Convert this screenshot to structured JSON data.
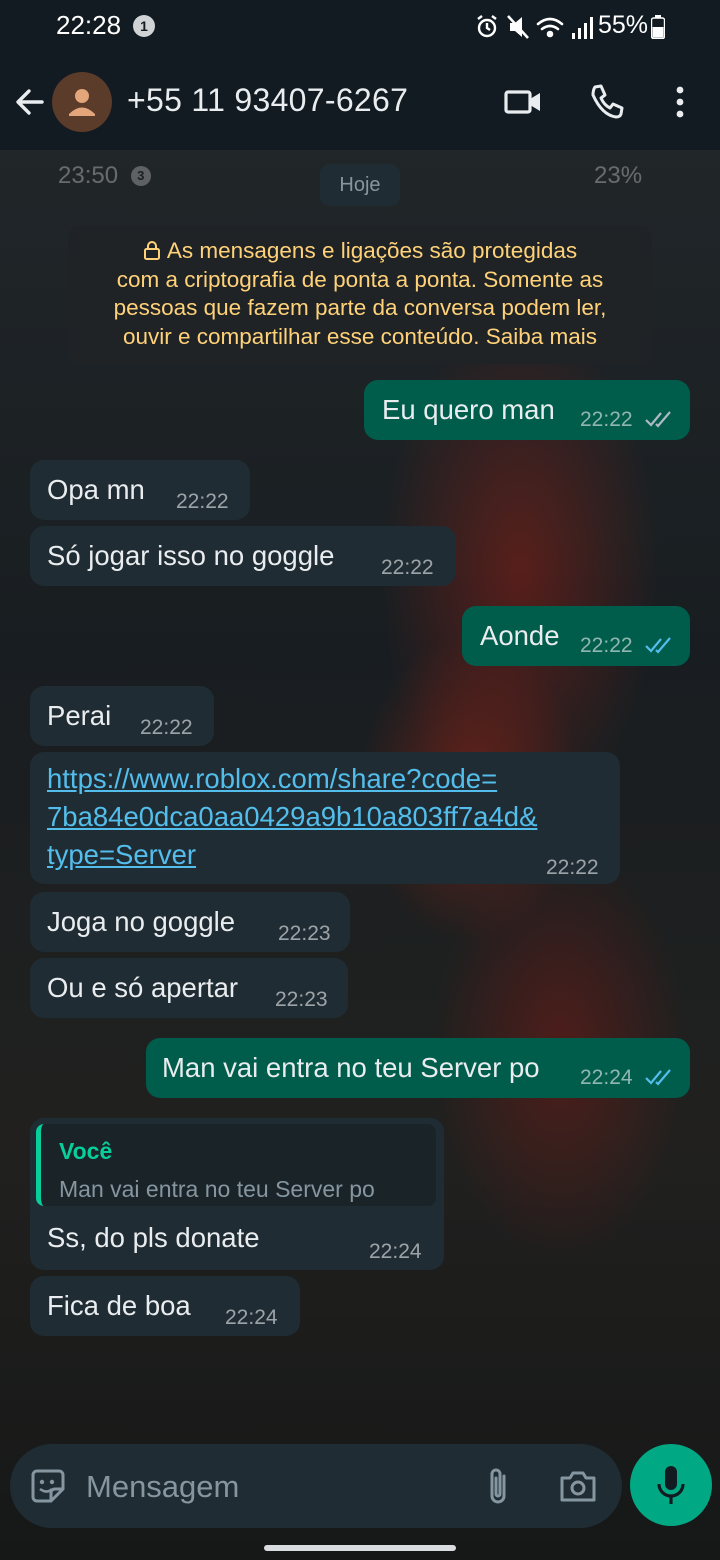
{
  "status_bar": {
    "time": "22:28",
    "notification_count": "1",
    "battery": "55%",
    "icons": [
      "alarm-icon",
      "mute-icon",
      "wifi-icon",
      "signal-icon",
      "battery-icon"
    ]
  },
  "header": {
    "contact": "+55 11 93407-6267",
    "icons": [
      "back-arrow-icon",
      "avatar-icon",
      "video-call-icon",
      "phone-icon",
      "more-vert-icon"
    ]
  },
  "wallpaper_ghost": {
    "time": "23:50",
    "badge": "3",
    "battery": "23%"
  },
  "chat": {
    "date_chip": "Hoje",
    "encryption_notice": [
      "As mensagens e ligações são protegidas",
      "com a criptografia de ponta a ponta. Somente as",
      "pessoas que fazem parte da conversa podem ler,",
      "ouvir e compartilhar esse conteúdo. Saiba mais"
    ],
    "messages": [
      {
        "dir": "out",
        "text": "Eu quero man",
        "time": "22:22",
        "status": "delivered"
      },
      {
        "dir": "in",
        "text": "Opa mn",
        "time": "22:22"
      },
      {
        "dir": "in",
        "text": "Só jogar isso no goggle",
        "time": "22:22"
      },
      {
        "dir": "out",
        "text": "Aonde",
        "time": "22:22",
        "status": "read"
      },
      {
        "dir": "in",
        "text": "Perai",
        "time": "22:22"
      },
      {
        "dir": "in",
        "link_lines": [
          "https://www.roblox.com/share?code=",
          "7ba84e0dca0aa0429a9b10a803ff7a4d&",
          "type=Server"
        ],
        "time": "22:22"
      },
      {
        "dir": "in",
        "text": "Joga no goggle",
        "time": "22:23"
      },
      {
        "dir": "in",
        "text": "Ou e só apertar",
        "time": "22:23"
      },
      {
        "dir": "out",
        "text": "Man vai entra no teu Server po",
        "time": "22:24",
        "status": "read"
      },
      {
        "dir": "in",
        "quote_author": "Você",
        "quote_text": "Man vai entra no teu Server po",
        "text": "Ss, do pls donate",
        "time": "22:24"
      },
      {
        "dir": "in",
        "text": "Fica de boa",
        "time": "22:24"
      }
    ]
  },
  "input": {
    "placeholder": "Mensagem",
    "icons": [
      "emoji-icon",
      "attach-icon",
      "camera-icon",
      "mic-icon"
    ]
  },
  "colors": {
    "incoming_bubble": "#202c33",
    "outgoing_bubble": "#005c4b",
    "read_check": "#53bdeb",
    "link": "#53bdeb",
    "accent": "#00a884",
    "notice_text": "#ffd279"
  }
}
